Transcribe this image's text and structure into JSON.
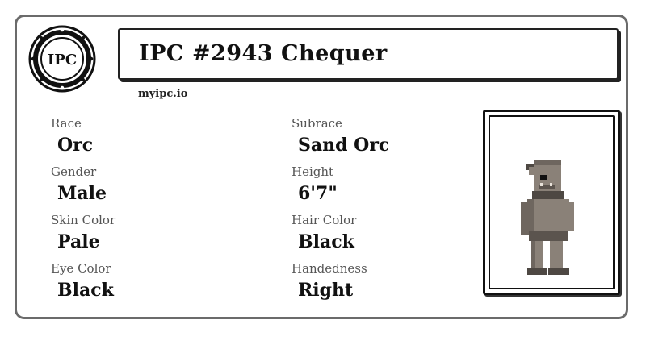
{
  "header": {
    "seal_text": "IPC",
    "title": "IPC #2943 Chequer",
    "site": "myipc.io"
  },
  "attributes": {
    "left": [
      {
        "label": "Race",
        "value": "Orc"
      },
      {
        "label": "Gender",
        "value": "Male"
      },
      {
        "label": "Skin Color",
        "value": "Pale"
      },
      {
        "label": "Eye Color",
        "value": "Black"
      }
    ],
    "right": [
      {
        "label": "Subrace",
        "value": "Sand Orc"
      },
      {
        "label": "Height",
        "value": "6'7\""
      },
      {
        "label": "Hair Color",
        "value": "Black"
      },
      {
        "label": "Handedness",
        "value": "Right"
      }
    ]
  },
  "colors": {
    "border": "#6b6b6b",
    "ink": "#111111",
    "label": "#555555",
    "skin": "#8a8178",
    "skin_dark": "#4e4843"
  },
  "icons": {
    "seal": "ipc-seal-icon",
    "portrait": "orc-character-sprite"
  }
}
